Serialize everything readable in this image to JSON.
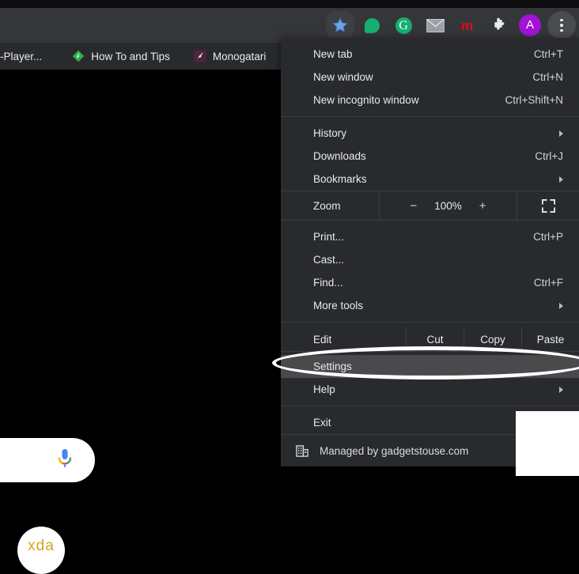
{
  "browser": {
    "toolbar_icons": [
      {
        "name": "bookmark-star-icon",
        "label": ""
      },
      {
        "name": "green-bubble-icon",
        "label": ""
      },
      {
        "name": "grammarly-icon",
        "label": "G"
      },
      {
        "name": "email-icon",
        "label": ""
      },
      {
        "name": "m-extension-icon",
        "label": "m"
      },
      {
        "name": "extensions-puzzle-icon",
        "label": ""
      },
      {
        "name": "profile-avatar",
        "label": "A"
      },
      {
        "name": "chrome-menu-icon",
        "label": ""
      }
    ],
    "bookmarks": [
      {
        "label": "-Player...",
        "icon": "none"
      },
      {
        "label": "How To and Tips",
        "icon": "feedly-icon"
      },
      {
        "label": "Monogatari",
        "icon": "monogatari-icon"
      }
    ],
    "newtab": {
      "search_placeholder": "",
      "mic_icon": "microphone-icon",
      "shortcut_label": "xda"
    }
  },
  "menu": {
    "groups": [
      {
        "items": [
          {
            "label": "New tab",
            "accel": "Ctrl+T",
            "submenu": false
          },
          {
            "label": "New window",
            "accel": "Ctrl+N",
            "submenu": false
          },
          {
            "label": "New incognito window",
            "accel": "Ctrl+Shift+N",
            "submenu": false
          }
        ]
      },
      {
        "items": [
          {
            "label": "History",
            "accel": "",
            "submenu": true
          },
          {
            "label": "Downloads",
            "accel": "Ctrl+J",
            "submenu": false
          },
          {
            "label": "Bookmarks",
            "accel": "",
            "submenu": true
          }
        ]
      }
    ],
    "zoom": {
      "label": "Zoom",
      "minus": "−",
      "level": "100%",
      "plus": "+",
      "fullscreen_icon": "fullscreen-icon"
    },
    "tools_group": [
      {
        "label": "Print...",
        "accel": "Ctrl+P",
        "submenu": false
      },
      {
        "label": "Cast...",
        "accel": "",
        "submenu": false
      },
      {
        "label": "Find...",
        "accel": "Ctrl+F",
        "submenu": false
      },
      {
        "label": "More tools",
        "accel": "",
        "submenu": true
      }
    ],
    "edit": {
      "label": "Edit",
      "actions": [
        "Cut",
        "Copy",
        "Paste"
      ]
    },
    "settings_group": [
      {
        "label": "Settings",
        "accel": "",
        "submenu": false,
        "selected": true
      },
      {
        "label": "Help",
        "accel": "",
        "submenu": true,
        "selected": false
      }
    ],
    "exit": {
      "label": "Exit",
      "accel": "",
      "submenu": false
    },
    "managed": {
      "label": "Managed by gadgetstouse.com",
      "icon": "building-icon"
    }
  },
  "annotations": {
    "highlight_shape": "ellipse",
    "highlight_target": "Settings",
    "highlight_color": "#ffffff"
  },
  "colors": {
    "menu_bg": "#292a2d",
    "toolbar_bg": "#35363a",
    "selected_row": "#4a4a4c",
    "text": "#e8eaed",
    "separator": "#3c3d40",
    "avatar": "#a412d6"
  }
}
